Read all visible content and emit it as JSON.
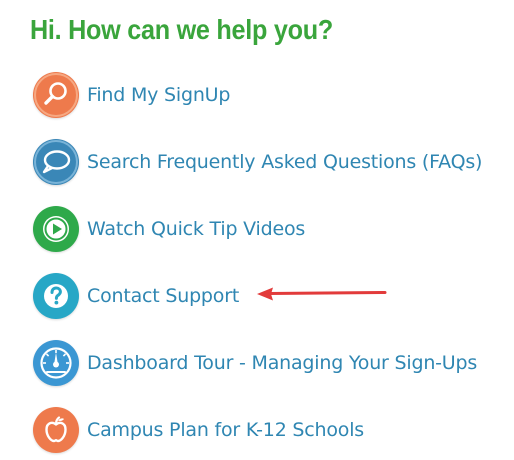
{
  "help": {
    "title": "Hi. How can we help you?",
    "items": [
      {
        "label": "Find My SignUp",
        "icon": "search-icon",
        "color": "#ee7a4c"
      },
      {
        "label": "Search Frequently Asked Questions (FAQs)",
        "icon": "chat-bubble-icon",
        "color": "#3a87b7"
      },
      {
        "label": "Watch Quick Tip Videos",
        "icon": "play-icon",
        "color": "#2ea94a"
      },
      {
        "label": "Contact Support",
        "icon": "question-icon",
        "color": "#27a7c6"
      },
      {
        "label": "Dashboard Tour - Managing Your Sign-Ups",
        "icon": "gauge-icon",
        "color": "#3b97d3"
      },
      {
        "label": "Campus Plan for K-12 Schools",
        "icon": "apple-icon",
        "color": "#ee7a4c"
      }
    ]
  },
  "annotation": {
    "arrow_color": "#e23b3b",
    "arrow_target": "Contact Support"
  }
}
